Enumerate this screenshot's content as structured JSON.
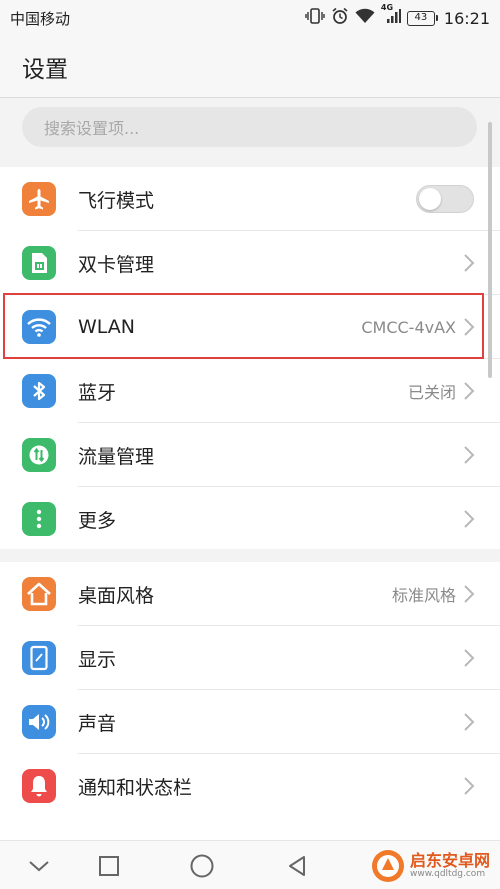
{
  "status_bar": {
    "carrier": "中国移动",
    "network": "4G",
    "battery": "43",
    "time": "16:21"
  },
  "header": {
    "title": "设置"
  },
  "search": {
    "placeholder": "搜索设置项..."
  },
  "settings_group_1": [
    {
      "label": "飞行模式",
      "icon": "airplane-icon",
      "color": "#f0813a",
      "control": "toggle",
      "toggle_on": false
    },
    {
      "label": "双卡管理",
      "icon": "sim-card-icon",
      "color": "#3dbb6a",
      "control": "chevron"
    },
    {
      "label": "WLAN",
      "icon": "wifi-icon",
      "color": "#3e8fe0",
      "value": "CMCC-4vAX",
      "control": "chevron",
      "highlighted": true
    },
    {
      "label": "蓝牙",
      "icon": "bluetooth-icon",
      "color": "#3e8fe0",
      "value": "已关闭",
      "control": "chevron"
    },
    {
      "label": "流量管理",
      "icon": "data-traffic-icon",
      "color": "#3dbb6a",
      "control": "chevron"
    },
    {
      "label": "更多",
      "icon": "more-icon",
      "color": "#3dbb6a",
      "control": "chevron"
    }
  ],
  "settings_group_2": [
    {
      "label": "桌面风格",
      "icon": "home-icon",
      "color": "#f0813a",
      "value": "标准风格",
      "control": "chevron"
    },
    {
      "label": "显示",
      "icon": "display-icon",
      "color": "#3e8fe0",
      "control": "chevron"
    },
    {
      "label": "声音",
      "icon": "sound-icon",
      "color": "#3e8fe0",
      "control": "chevron"
    },
    {
      "label": "通知和状态栏",
      "icon": "notification-bell-icon",
      "color": "#ee4b4b",
      "control": "chevron"
    }
  ],
  "nav_bar": [
    "chevron-down-icon",
    "recent-apps-icon",
    "home-circle-icon",
    "back-triangle-icon"
  ],
  "watermark": {
    "title": "启东安卓网",
    "url": "www.qdltdg.com"
  }
}
